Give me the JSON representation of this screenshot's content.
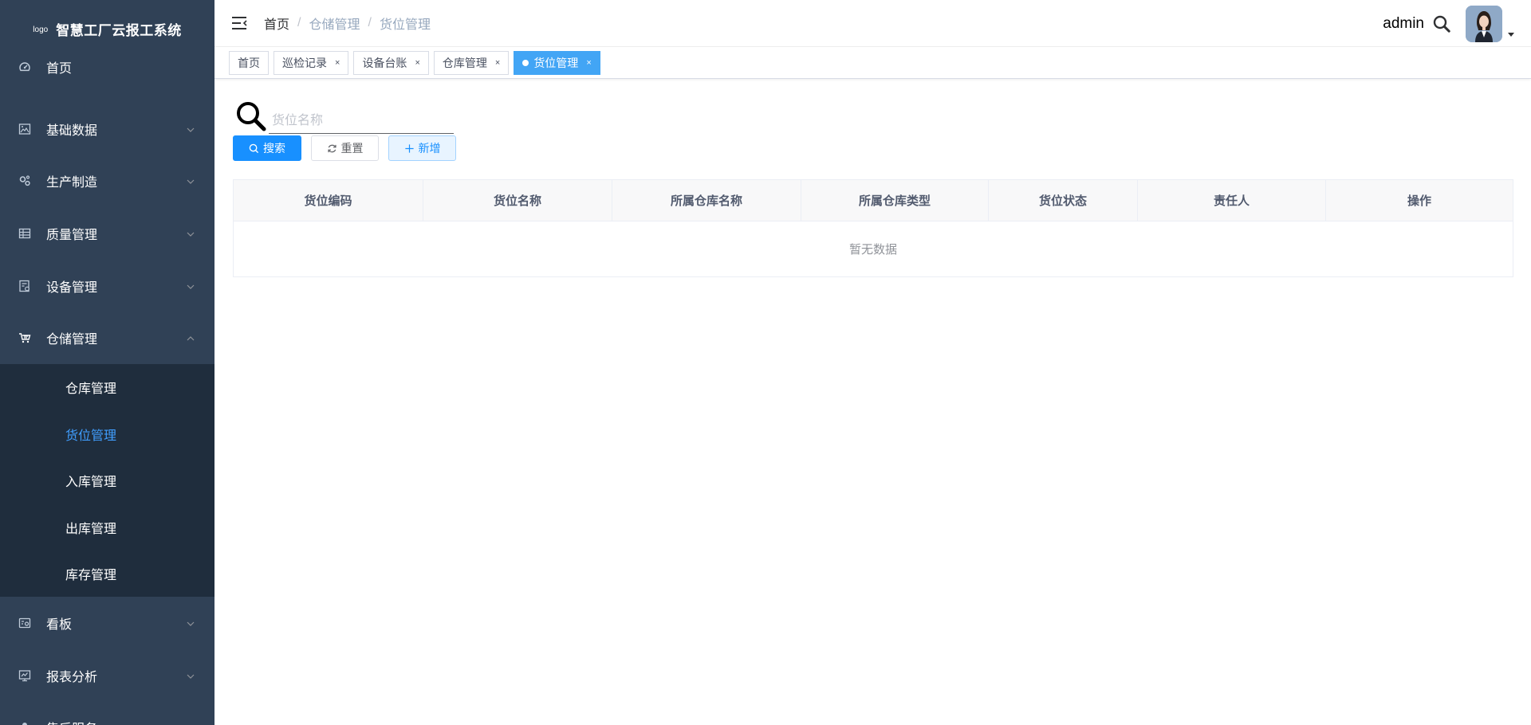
{
  "sidebar": {
    "logo_text": "logo",
    "title": "智慧工厂云报工系统",
    "items": [
      {
        "label": "首页",
        "icon": "dashboard-icon"
      },
      {
        "label": "基础数据",
        "icon": "picture-icon"
      },
      {
        "label": "生产制造",
        "icon": "gears-icon"
      },
      {
        "label": "质量管理",
        "icon": "table-icon"
      },
      {
        "label": "设备管理",
        "icon": "device-icon"
      },
      {
        "label": "仓储管理",
        "icon": "cart-icon"
      },
      {
        "label": "看板",
        "icon": "board-icon"
      },
      {
        "label": "报表分析",
        "icon": "report-icon"
      },
      {
        "label": "售后服务",
        "icon": "service-icon"
      }
    ],
    "warehouse_sub": [
      "仓库管理",
      "货位管理",
      "入库管理",
      "出库管理",
      "库存管理"
    ],
    "active_sub": "货位管理"
  },
  "navbar": {
    "breadcrumb": [
      "首页",
      "仓储管理",
      "货位管理"
    ],
    "separator": "/",
    "username": "admin"
  },
  "tags": [
    {
      "label": "首页",
      "closable": false
    },
    {
      "label": "巡检记录",
      "closable": true
    },
    {
      "label": "设备台账",
      "closable": true
    },
    {
      "label": "仓库管理",
      "closable": true
    },
    {
      "label": "货位管理",
      "closable": true,
      "active": true
    }
  ],
  "tag_close_glyph": "×",
  "search": {
    "placeholder": "货位名称",
    "value": ""
  },
  "buttons": {
    "search": "搜索",
    "reset": "重置",
    "add": "新增"
  },
  "table": {
    "columns": [
      "货位编码",
      "货位名称",
      "所属仓库名称",
      "所属仓库类型",
      "货位状态",
      "责任人",
      "操作"
    ],
    "empty_text": "暂无数据"
  },
  "colors": {
    "sidebar_bg": "#304156",
    "submenu_bg": "#1f2d3d",
    "active_text": "#409eff",
    "primary": "#1890ff",
    "active_tag": "#42a5f5"
  }
}
